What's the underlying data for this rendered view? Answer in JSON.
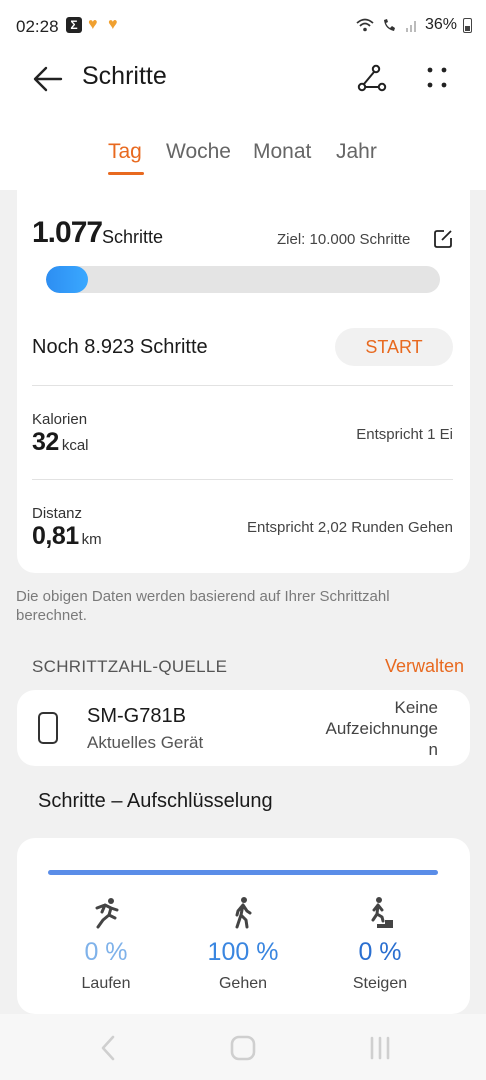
{
  "status": {
    "time": "02:28",
    "battery": "36%"
  },
  "header": {
    "title": "Schritte"
  },
  "tabs": [
    {
      "label": "Tag"
    },
    {
      "label": "Woche"
    },
    {
      "label": "Monat"
    },
    {
      "label": "Jahr"
    }
  ],
  "summary": {
    "steps_value": "1.077",
    "steps_unit": "Schritte",
    "goal": "Ziel: 10.000 Schritte",
    "progress_fraction": 0.1077,
    "remaining": "Noch 8.923 Schritte",
    "start_label": "START"
  },
  "metrics": {
    "calories": {
      "label": "Kalorien",
      "value": "32",
      "unit": "kcal",
      "note": "Entspricht 1 Ei"
    },
    "distance": {
      "label": "Distanz",
      "value": "0,81",
      "unit": "km",
      "note": "Entspricht 2,02 Runden Gehen"
    }
  },
  "info_note": "Die obigen Daten werden basierend auf Ihrer Schrittzahl berechnet.",
  "source": {
    "section_title": "SCHRITTZAHL-QUELLE",
    "manage_label": "Verwalten",
    "device_name": "SM-G781B",
    "device_sub": "Aktuelles Gerät",
    "status_line1": "Keine",
    "status_line2": "Aufzeichnunge",
    "status_line3": "n"
  },
  "breakdown": {
    "title": "Schritte – Aufschlüsselung",
    "items": [
      {
        "pct": "0 %",
        "label": "Laufen",
        "color": "#7fb2ea"
      },
      {
        "pct": "100 %",
        "label": "Gehen",
        "color": "#3a86e0"
      },
      {
        "pct": "0 %",
        "label": "Steigen",
        "color": "#2a6fd0"
      }
    ]
  },
  "colors": {
    "accent": "#e8691f",
    "progress": "#2d8ef2"
  }
}
